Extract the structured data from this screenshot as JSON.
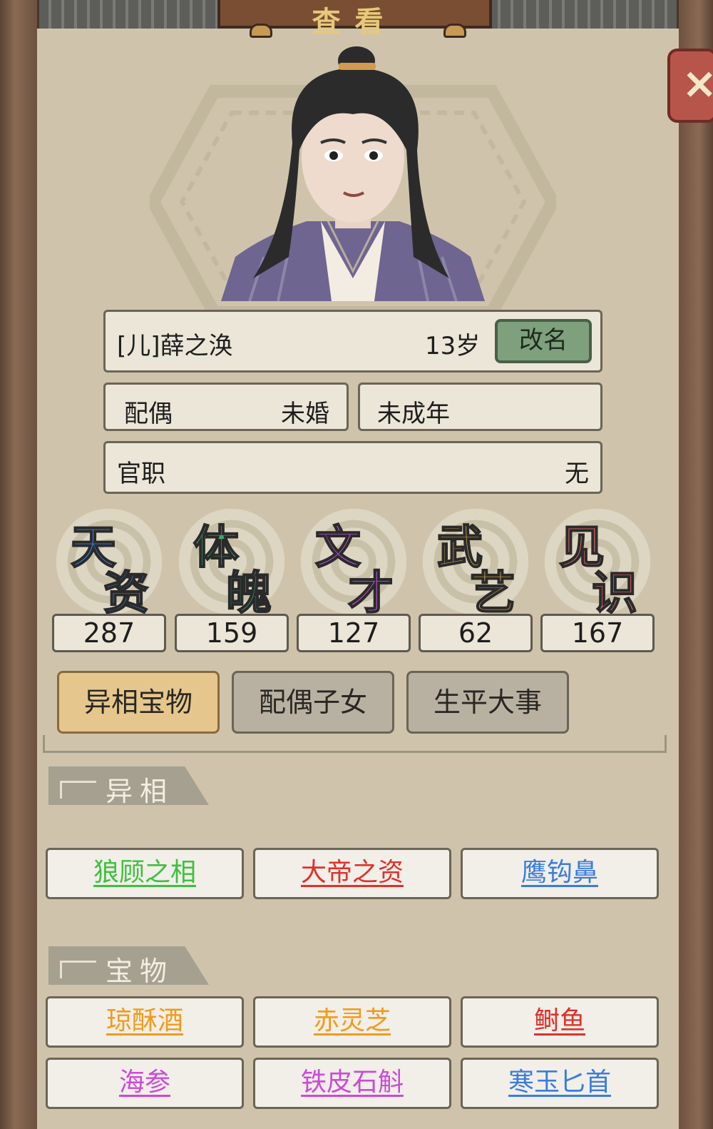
{
  "title": "查看",
  "close_label": "×",
  "profile": {
    "name": "[儿]薛之涣",
    "age": "13岁",
    "rename_label": "改名",
    "spouse_key": "配偶",
    "spouse_value": "未婚",
    "adult_status": "未成年",
    "office_key": "官职",
    "office_value": "无"
  },
  "stats": [
    {
      "label_top": "天",
      "label_bottom": "资",
      "value": "287",
      "color": "#3f7fd6"
    },
    {
      "label_top": "体",
      "label_bottom": "魄",
      "value": "159",
      "color": "#3fa86c"
    },
    {
      "label_top": "文",
      "label_bottom": "才",
      "value": "127",
      "color": "#b84fd0"
    },
    {
      "label_top": "武",
      "label_bottom": "艺",
      "value": "62",
      "color": "#d6a84a"
    },
    {
      "label_top": "见",
      "label_bottom": "识",
      "value": "167",
      "color": "#e06a6a"
    }
  ],
  "tabs": [
    {
      "label": "异相宝物",
      "active": true
    },
    {
      "label": "配偶子女",
      "active": false
    },
    {
      "label": "生平大事",
      "active": false
    }
  ],
  "sections": {
    "traits": {
      "header": "异相",
      "items": [
        {
          "label": "狼顾之相",
          "color": "#3fbf3f"
        },
        {
          "label": "大帝之资",
          "color": "#e0312c"
        },
        {
          "label": "鹰钩鼻",
          "color": "#3a7be0"
        }
      ]
    },
    "treasures": {
      "header": "宝物",
      "items": [
        {
          "label": "琼酥酒",
          "color": "#f39a1a"
        },
        {
          "label": "赤灵芝",
          "color": "#f39a1a"
        },
        {
          "label": "鲥鱼",
          "color": "#e0312c"
        },
        {
          "label": "海参",
          "color": "#cc4ad8"
        },
        {
          "label": "铁皮石斛",
          "color": "#cc4ad8"
        },
        {
          "label": "寒玉匕首",
          "color": "#3a7be0"
        }
      ]
    }
  }
}
